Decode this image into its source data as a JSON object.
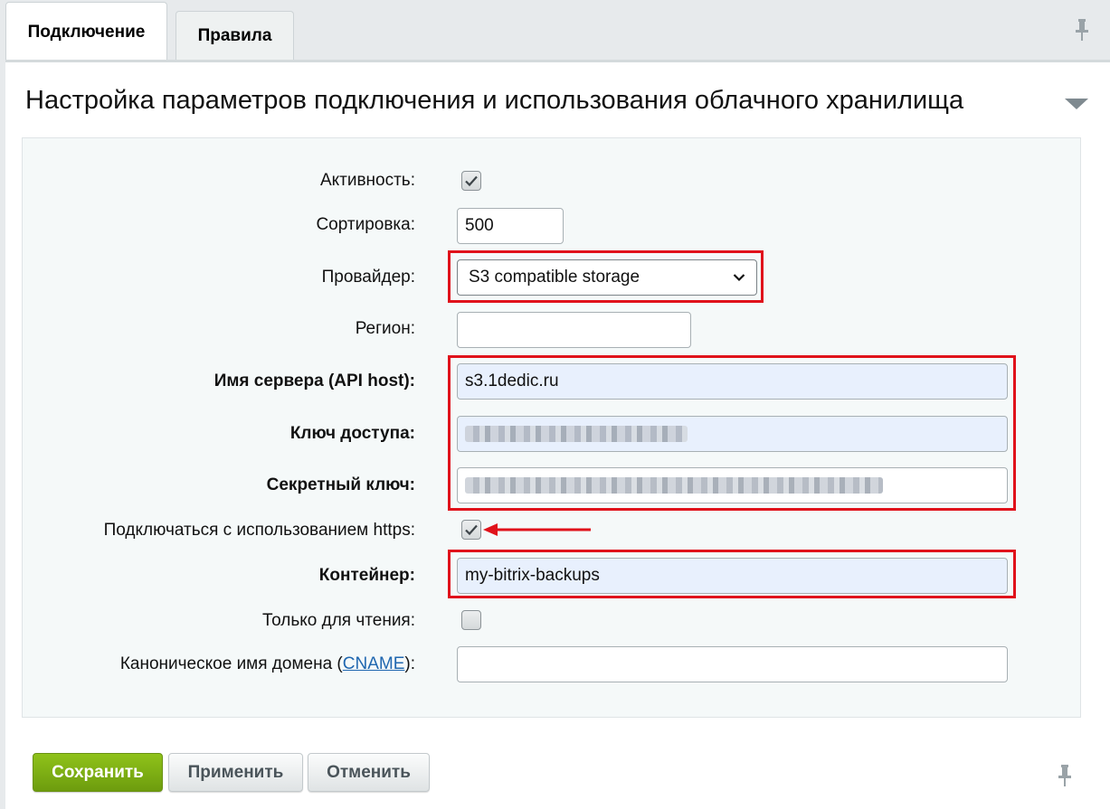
{
  "tabs": [
    {
      "label": "Подключение",
      "active": true
    },
    {
      "label": "Правила",
      "active": false
    }
  ],
  "section": {
    "title": "Настройка параметров подключения и использования облачного хранилища"
  },
  "form": {
    "active_label": "Активность:",
    "active_checked": true,
    "sort_label": "Сортировка:",
    "sort_value": "500",
    "provider_label": "Провайдер:",
    "provider_value": "S3 compatible storage",
    "region_label": "Регион:",
    "region_value": "",
    "server_label": "Имя сервера (API host):",
    "server_value": "s3.1dedic.ru",
    "access_key_label": "Ключ доступа:",
    "secret_key_label": "Секретный ключ:",
    "https_label": "Подключаться с использованием https:",
    "https_checked": true,
    "container_label": "Контейнер:",
    "container_value": "my-bitrix-backups",
    "readonly_label": "Только для чтения:",
    "readonly_checked": false,
    "cname_label_prefix": "Каноническое имя домена (",
    "cname_link": "CNAME",
    "cname_label_suffix": "):",
    "cname_value": ""
  },
  "buttons": {
    "save": "Сохранить",
    "apply": "Применить",
    "cancel": "Отменить"
  },
  "colors": {
    "highlight": "#e0121b",
    "save_green": "#7cae14",
    "link": "#2067b0"
  }
}
